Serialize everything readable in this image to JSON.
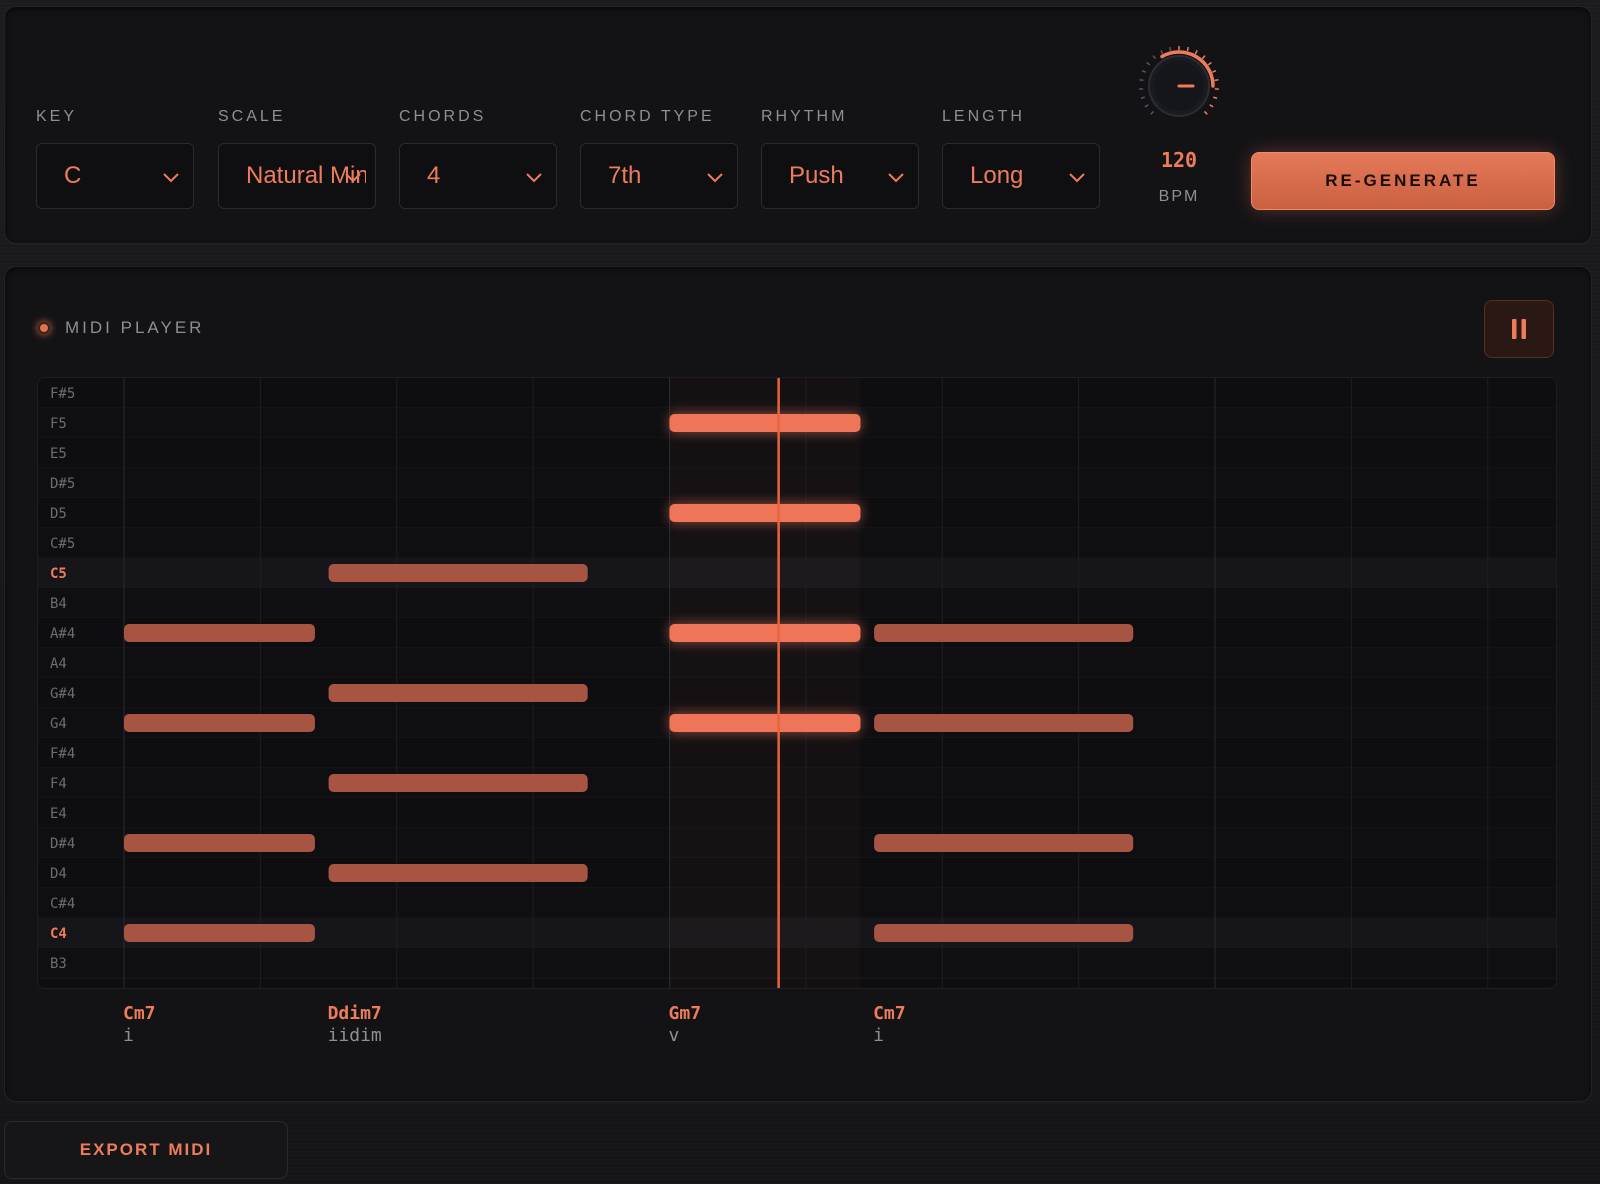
{
  "controls": [
    {
      "id": "key",
      "label": "KEY",
      "value": "C"
    },
    {
      "id": "scale",
      "label": "SCALE",
      "value": "Natural Minor"
    },
    {
      "id": "chords",
      "label": "CHORDS",
      "value": "4"
    },
    {
      "id": "chord-type",
      "label": "CHORD TYPE",
      "value": "7th"
    },
    {
      "id": "rhythm",
      "label": "RHYTHM",
      "value": "Push"
    },
    {
      "id": "length",
      "label": "LENGTH",
      "value": "Long"
    }
  ],
  "tempo": {
    "value": "120",
    "label": "BPM"
  },
  "regenerate_label": "RE-GENERATE",
  "player": {
    "title": "MIDI PLAYER",
    "playing": true
  },
  "export_label": "EXPORT MIDI",
  "colors": {
    "accent": "#ee7c5b",
    "note": "#a85443",
    "note_active": "#ee7558",
    "playhead": "#e8643f"
  },
  "piano_roll": {
    "pitches": [
      "F#5",
      "F5",
      "E5",
      "D#5",
      "D5",
      "C#5",
      "C5",
      "B4",
      "A#4",
      "A4",
      "G#4",
      "G4",
      "F#4",
      "F4",
      "E4",
      "D#4",
      "D4",
      "C#4",
      "C4",
      "B3"
    ],
    "highlighted": [
      "C5",
      "C4"
    ],
    "total_beats": 10.5,
    "playhead_beat": 4.8,
    "active_chord": 2,
    "chords": [
      {
        "name": "Cm7",
        "roman": "i",
        "start": 0,
        "length": 1.4,
        "notes": [
          "A#4",
          "G4",
          "D#4",
          "C4"
        ]
      },
      {
        "name": "Ddim7",
        "roman": "iidim",
        "start": 1.5,
        "length": 1.9,
        "notes": [
          "C5",
          "G#4",
          "F4",
          "D4"
        ]
      },
      {
        "name": "Gm7",
        "roman": "v",
        "start": 4.0,
        "length": 1.4,
        "notes": [
          "F5",
          "D5",
          "A#4",
          "G4"
        ]
      },
      {
        "name": "Cm7",
        "roman": "i",
        "start": 5.5,
        "length": 1.9,
        "notes": [
          "A#4",
          "G4",
          "D#4",
          "C4"
        ]
      }
    ]
  }
}
